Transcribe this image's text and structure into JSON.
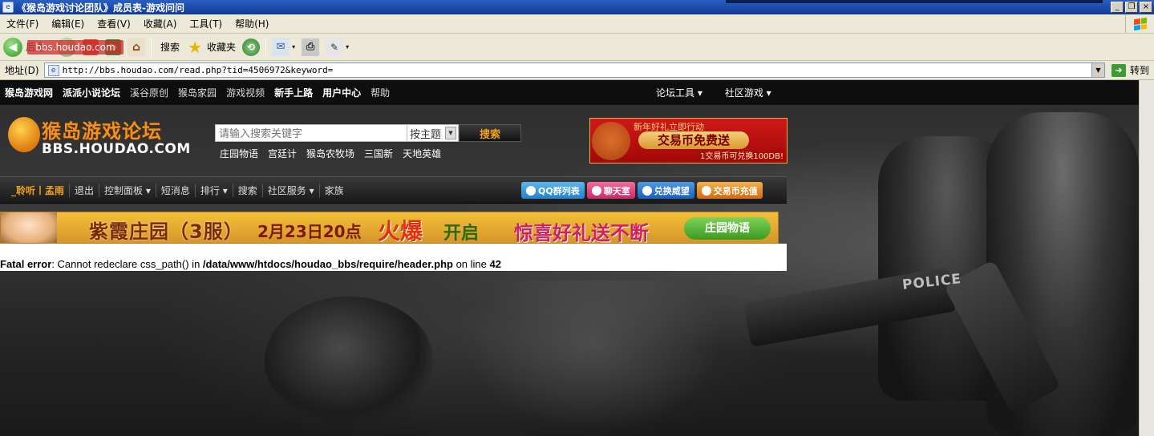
{
  "window": {
    "title": "《猴岛游戏讨论团队》成员表-游戏问问",
    "buttons": [
      "_",
      "❐",
      "×"
    ]
  },
  "menu": {
    "items": [
      "文件(F)",
      "编辑(E)",
      "查看(V)",
      "收藏(A)",
      "工具(T)",
      "帮助(H)"
    ]
  },
  "toolbar": {
    "back": "后退",
    "search": "搜索",
    "favorites": "收藏夹",
    "watermark": "bbs.houdao.com"
  },
  "address": {
    "label": "地址(D)",
    "url": "http://bbs.houdao.com/read.php?tid=4506972&keyword=",
    "go": "转到"
  },
  "site": {
    "topnav_left": [
      {
        "label": "猴岛游戏网",
        "bold": true
      },
      {
        "label": "派派小说论坛",
        "bold": true
      },
      {
        "label": "溪谷原创",
        "bold": false
      },
      {
        "label": "猴岛家园",
        "bold": false
      },
      {
        "label": "游戏视频",
        "bold": false
      },
      {
        "label": "新手上路",
        "bold": true
      },
      {
        "label": "用户中心",
        "bold": true
      },
      {
        "label": "帮助",
        "bold": false
      }
    ],
    "topnav_right": [
      "论坛工具 ▾",
      "社区游戏 ▾"
    ],
    "logo_cn": "猴岛游戏论坛",
    "logo_en": "BBS.HOUDAO.COM",
    "search_placeholder": "请输入搜索关键字",
    "search_type": "按主题",
    "search_button": "搜索",
    "hotlinks": [
      "庄园物语",
      "宫廷计",
      "猴岛农牧场",
      "三国新",
      "天地英雄"
    ],
    "banner_top": {
      "line1": "新年好礼立即行动",
      "line2": "交易币免费送",
      "line3": "1交易币可兑换100DB!"
    },
    "forumbar": {
      "user": "_聆听丨孟雨",
      "items": [
        "退出",
        "控制面板 ▾",
        "短消息",
        "排行 ▾",
        "搜索",
        "社区服务 ▾",
        "家族"
      ],
      "buttons": [
        "QQ群列表",
        "聊天室",
        "兑换威望",
        "交易币充值"
      ]
    },
    "banner_mid": {
      "t1": "紫霞庄园（3服）",
      "t2": "2月23日20点",
      "t3": "火爆",
      "t4": "开启",
      "t5": "惊喜好礼送不断",
      "t6": "庄园物语"
    },
    "error": {
      "label": "Fatal error",
      "message": ": Cannot redeclare css_path() in ",
      "path": "/data/www/htdocs/houdao_bbs/require/header.php",
      "line_text": " on line ",
      "line_no": "42"
    },
    "art_police": "POLICE"
  }
}
